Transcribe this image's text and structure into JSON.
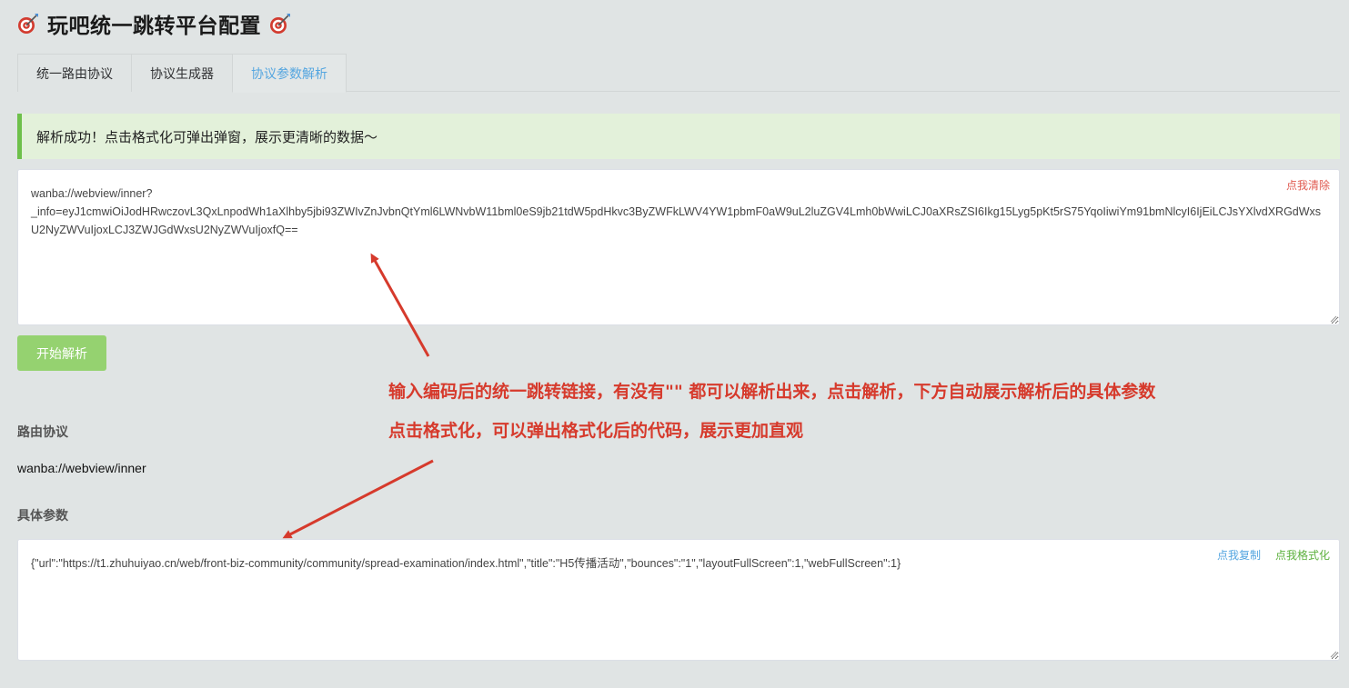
{
  "header": {
    "title": "玩吧统一跳转平台配置"
  },
  "tabs": [
    {
      "label": "统一路由协议"
    },
    {
      "label": "协议生成器"
    },
    {
      "label": "协议参数解析"
    }
  ],
  "alert": {
    "message": "解析成功！点击格式化可弹出弹窗，展示更清晰的数据～"
  },
  "input": {
    "value": "wanba://webview/inner?\n_info=eyJ1cmwiOiJodHRwczovL3QxLnpodWh1aXlhby5jbi93ZWIvZnJvbnQtYml6LWNvbW11bml0eS9jb21tdW5pdHkvc3ByZWFkLWV4YW1pbmF0aW9uL2luZGV4Lmh0bWwiLCJ0aXRsZSI6Ikg15Lyg5pKt5rS75YqoIiwiYm91bmNlcyI6IjEiLCJsYXlvdXRGdWxsU2NyZWVuIjoxLCJ3ZWJGdWxsU2NyZWVuIjoxfQ==",
    "clear_label": "点我清除"
  },
  "parse_button": {
    "label": "开始解析"
  },
  "annotations": {
    "line1": "输入编码后的统一跳转链接，有没有\"\" 都可以解析出来，点击解析，下方自动展示解析后的具体参数",
    "line2": "点击格式化，可以弹出格式化后的代码，展示更加直观"
  },
  "route": {
    "label": "路由协议",
    "value": "wanba://webview/inner"
  },
  "params": {
    "label": "具体参数",
    "value": "{\"url\":\"https://t1.zhuhuiyao.cn/web/front-biz-community/community/spread-examination/index.html\",\"title\":\"H5传播活动\",\"bounces\":\"1\",\"layoutFullScreen\":1,\"webFullScreen\":1}",
    "copy_label": "点我复制",
    "format_label": "点我格式化"
  },
  "colors": {
    "accent_blue": "#55a6e0",
    "success_green": "#6ec04b",
    "danger_red": "#d63a2c",
    "button_green": "#95d270"
  },
  "icons": [
    "dart-target-icon"
  ]
}
